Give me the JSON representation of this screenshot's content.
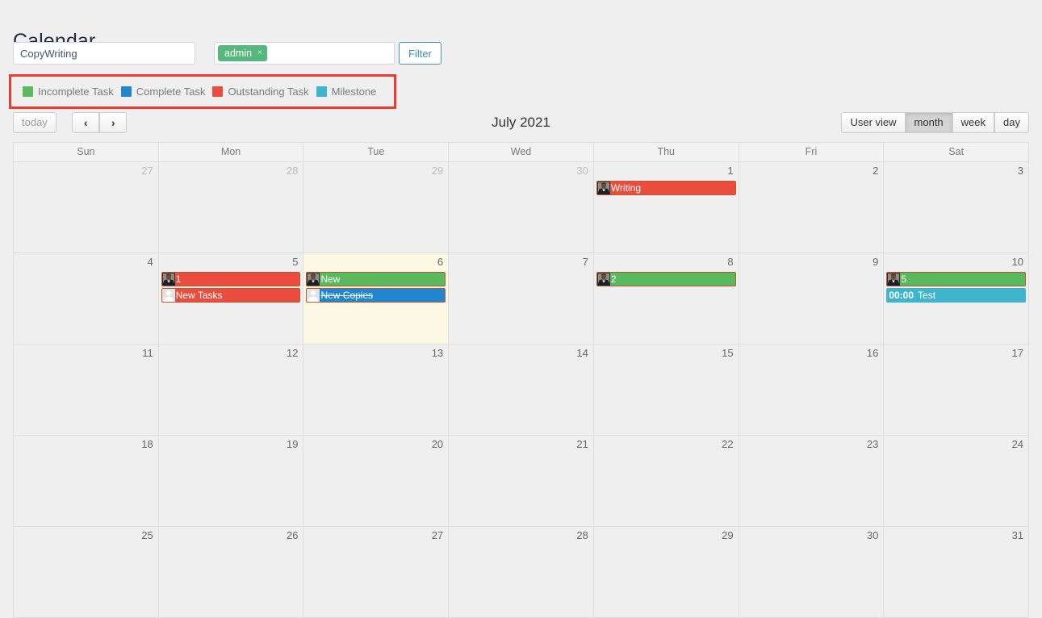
{
  "page": {
    "title": "Calendar"
  },
  "filter": {
    "search_value": "CopyWriting",
    "search_placeholder": "",
    "user_token": "admin",
    "token_remove_icon": "×",
    "filter_button": "Filter"
  },
  "legend": {
    "items": [
      {
        "label": "Incomplete Task",
        "color": "#5cb85c"
      },
      {
        "label": "Complete Task",
        "color": "#2186cd"
      },
      {
        "label": "Outstanding Task",
        "color": "#ea4d3d"
      },
      {
        "label": "Milestone",
        "color": "#3fb5cd"
      }
    ],
    "highlight_color": "#ef3b2d"
  },
  "toolbar": {
    "today_label": "today",
    "prev_icon": "‹",
    "next_icon": "›",
    "title": "July 2021",
    "views": [
      {
        "label": "User view",
        "active": false
      },
      {
        "label": "month",
        "active": true
      },
      {
        "label": "week",
        "active": false
      },
      {
        "label": "day",
        "active": false
      }
    ]
  },
  "calendar": {
    "day_headers": [
      "Sun",
      "Mon",
      "Tue",
      "Wed",
      "Thu",
      "Fri",
      "Sat"
    ],
    "weeks": [
      [
        {
          "num": "27",
          "other": true
        },
        {
          "num": "28",
          "other": true
        },
        {
          "num": "29",
          "other": true
        },
        {
          "num": "30",
          "other": true
        },
        {
          "num": "1",
          "other": false,
          "events": [
            {
              "title": "Writing",
              "type": "outstanding",
              "color": "#ea4d3d",
              "avatar": "photo",
              "done": false
            }
          ]
        },
        {
          "num": "2",
          "other": false
        },
        {
          "num": "3",
          "other": false
        }
      ],
      [
        {
          "num": "4",
          "other": false
        },
        {
          "num": "5",
          "other": false,
          "events": [
            {
              "title": "1",
              "type": "outstanding",
              "color": "#ea4d3d",
              "avatar": "photo",
              "done": false
            },
            {
              "title": "New Tasks",
              "type": "outstanding",
              "color": "#ea4d3d",
              "avatar": "silhouette",
              "done": false
            }
          ]
        },
        {
          "num": "6",
          "other": false,
          "today": true,
          "events": [
            {
              "title": "New",
              "type": "incomplete",
              "color": "#5cb85c",
              "avatar": "photo",
              "done": false
            },
            {
              "title": "New Copies",
              "type": "complete",
              "color": "#2186cd",
              "avatar": "silhouette",
              "done": true
            }
          ]
        },
        {
          "num": "7",
          "other": false
        },
        {
          "num": "8",
          "other": false,
          "events": [
            {
              "title": "2",
              "type": "incomplete",
              "color": "#5cb85c",
              "avatar": "photo",
              "done": false
            }
          ]
        },
        {
          "num": "9",
          "other": false
        },
        {
          "num": "10",
          "other": false,
          "events": [
            {
              "title": "5",
              "type": "incomplete",
              "color": "#5cb85c",
              "avatar": "photo",
              "done": false
            },
            {
              "title": "Test",
              "type": "milestone",
              "color": "#3fb5cd",
              "time": "00:00",
              "noborder": true,
              "done": false
            }
          ]
        }
      ],
      [
        {
          "num": "11",
          "other": false
        },
        {
          "num": "12",
          "other": false
        },
        {
          "num": "13",
          "other": false
        },
        {
          "num": "14",
          "other": false
        },
        {
          "num": "15",
          "other": false
        },
        {
          "num": "16",
          "other": false
        },
        {
          "num": "17",
          "other": false
        }
      ],
      [
        {
          "num": "18",
          "other": false
        },
        {
          "num": "19",
          "other": false
        },
        {
          "num": "20",
          "other": false
        },
        {
          "num": "21",
          "other": false
        },
        {
          "num": "22",
          "other": false
        },
        {
          "num": "23",
          "other": false
        },
        {
          "num": "24",
          "other": false
        }
      ],
      [
        {
          "num": "25",
          "other": false
        },
        {
          "num": "26",
          "other": false
        },
        {
          "num": "27",
          "other": false
        },
        {
          "num": "28",
          "other": false
        },
        {
          "num": "29",
          "other": false
        },
        {
          "num": "30",
          "other": false
        },
        {
          "num": "31",
          "other": false
        }
      ]
    ]
  }
}
